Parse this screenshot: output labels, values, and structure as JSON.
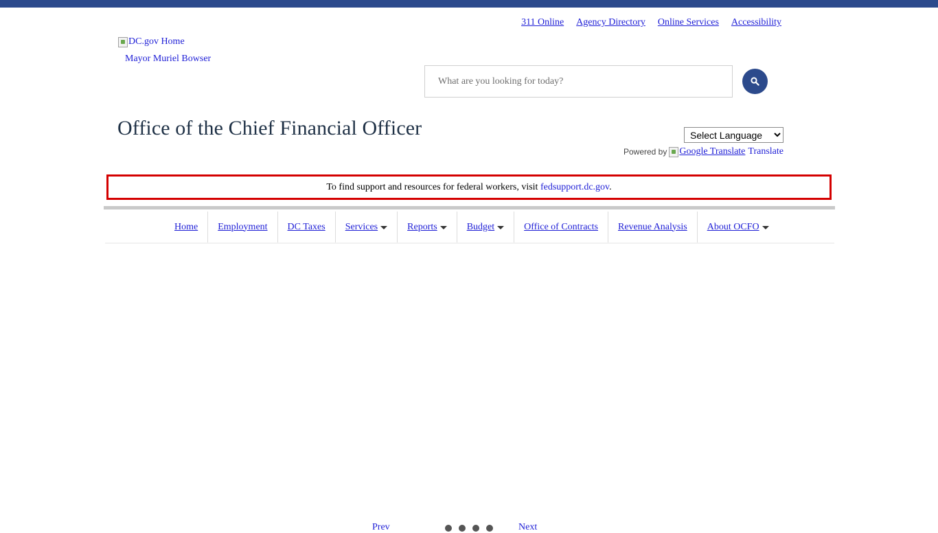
{
  "utility_nav": [
    "311 Online",
    "Agency Directory",
    "Online Services",
    "Accessibility"
  ],
  "logo": {
    "alt": "DC.gov Home"
  },
  "mayor_link": "Mayor Muriel Bowser",
  "search": {
    "placeholder": "What are you looking for today?",
    "icon": "search-icon"
  },
  "site_title": "Office of the Chief Financial Officer",
  "language": {
    "selected": "Select Language",
    "powered_by": "Powered by",
    "google_alt": "Google Translate",
    "translate_link": "Translate"
  },
  "alert": {
    "text_before": "To find support and resources for federal workers, visit ",
    "link": "fedsupport.dc.gov",
    "text_after": "."
  },
  "main_nav": [
    {
      "label": "Home"
    },
    {
      "label": "Employment"
    },
    {
      "label": "DC Taxes"
    },
    {
      "label": "Services",
      "dropdown": true
    },
    {
      "label": "Reports",
      "dropdown": true
    },
    {
      "label": "Budget",
      "dropdown": true
    },
    {
      "label": "Office of Contracts"
    },
    {
      "label": "Revenue Analysis"
    },
    {
      "label": "About OCFO",
      "dropdown": true
    }
  ],
  "slider": {
    "prev": "Prev",
    "next": "Next",
    "dot_count": 4
  },
  "colors": {
    "brand_blue": "#2c4a8c",
    "alert_border": "#d40000",
    "title": "#1f3146",
    "link": "#1d1dd6"
  }
}
